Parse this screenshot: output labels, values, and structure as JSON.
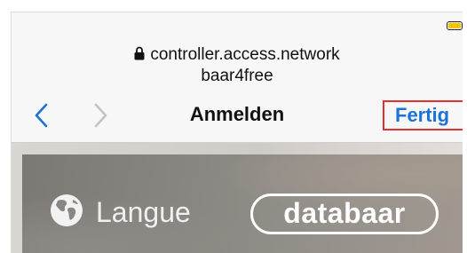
{
  "browser": {
    "url": "controller.access.network",
    "site_name": "baar4free"
  },
  "status_bar": {
    "battery_level": 1.0,
    "battery_color": "#f5c400"
  },
  "toolbar": {
    "back_icon": "chevron-left-icon",
    "forward_icon": "chevron-right-icon",
    "title": "Anmelden",
    "done_label": "Fertig",
    "accent_color": "#1a73d9",
    "highlight_color": "#e03131"
  },
  "content": {
    "language_label": "Langue",
    "language_icon": "globe-icon",
    "brand_logo_text": "databaar"
  }
}
